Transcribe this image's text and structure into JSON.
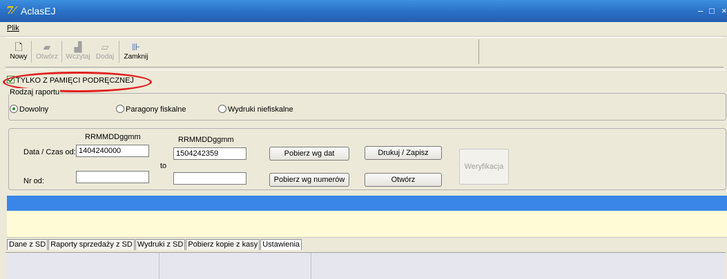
{
  "window": {
    "title": "AclasEJ",
    "minimize": "–",
    "maximize": "□",
    "close": "×"
  },
  "menu": {
    "items": [
      {
        "label": "Plik"
      }
    ]
  },
  "toolbar": {
    "buttons": [
      {
        "label": "Nowy",
        "icon": "new-document-icon",
        "enabled": true
      },
      {
        "label": "Otwórz",
        "icon": "open-icon",
        "enabled": false
      },
      {
        "label": "Wczytaj",
        "icon": "load-icon",
        "enabled": false
      },
      {
        "label": "Dodaj",
        "icon": "add-icon",
        "enabled": false
      },
      {
        "label": "Zamknij",
        "icon": "close-door-icon",
        "enabled": true
      }
    ]
  },
  "memory_checkbox": {
    "label": "TYLKO Z PAMIĘCI PODRĘCZNEJ",
    "checked": true
  },
  "report_type": {
    "legend": "Rodzaj raportu",
    "options": [
      {
        "label": "Dowolny",
        "selected": true
      },
      {
        "label": "Paragony fiskalne",
        "selected": false
      },
      {
        "label": "Wydruki niefiskalne",
        "selected": false
      }
    ]
  },
  "filters": {
    "date_format_from": "RRMMDDggmm",
    "date_format_to": "RRMMDDggmm",
    "date_label": "Data / Czas od:",
    "to_label": "to",
    "nr_label": "Nr od:",
    "date_from": "1404240000",
    "date_to": "1504242359",
    "nr_from": "",
    "nr_to": "",
    "btn_fetch_dates": "Pobierz wg dat",
    "btn_fetch_numbers": "Pobierz wg numerów",
    "btn_print_save": "Drukuj / Zapisz",
    "btn_open": "Otwórz",
    "btn_verify": "Weryfikacja"
  },
  "tabs": [
    {
      "label": "Dane z SD"
    },
    {
      "label": "Raporty sprzedaży z SD"
    },
    {
      "label": "Wydruki z SD"
    },
    {
      "label": "Pobierz kopie z kasy"
    },
    {
      "label": "Ustawienia"
    }
  ],
  "colors": {
    "titlebar": "#2b72c8",
    "selected_row": "#3a86e8",
    "highlight_ring": "#e02020",
    "grid_bg": "#fffbd6"
  }
}
